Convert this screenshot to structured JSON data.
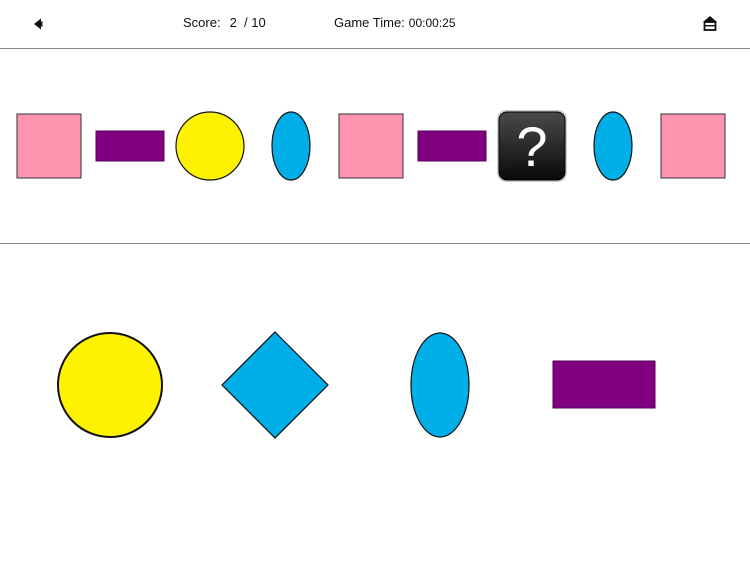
{
  "header": {
    "back_icon": "back-arrow-icon",
    "home_icon": "home-icon",
    "score_label": "Score:",
    "score_value": "2  / 10",
    "time_label": "Game Time:",
    "time_value": "00:00:25"
  },
  "sequence": {
    "items": [
      {
        "shape": "square",
        "color": "#ff94b0"
      },
      {
        "shape": "rectangle",
        "color": "#800080"
      },
      {
        "shape": "circle",
        "color": "#fff200"
      },
      {
        "shape": "ellipse",
        "color": "#00aee8"
      },
      {
        "shape": "square",
        "color": "#ff94b0"
      },
      {
        "shape": "rectangle",
        "color": "#800080"
      },
      {
        "shape": "question",
        "label": "?"
      },
      {
        "shape": "ellipse",
        "color": "#00aee8"
      },
      {
        "shape": "square",
        "color": "#ff94b0"
      }
    ]
  },
  "choices": {
    "items": [
      {
        "shape": "circle",
        "color": "#fff200"
      },
      {
        "shape": "diamond",
        "color": "#00aee8"
      },
      {
        "shape": "ellipse",
        "color": "#00aee8"
      },
      {
        "shape": "rectangle",
        "color": "#800080"
      }
    ]
  }
}
